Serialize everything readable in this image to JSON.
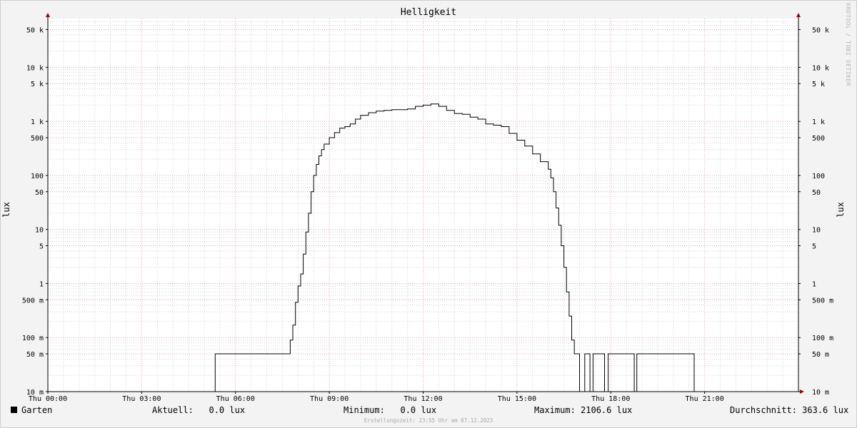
{
  "chart_data": {
    "type": "line",
    "title": "Helligkeit",
    "ylabel": "lux",
    "y_scale": "log",
    "ylim": [
      0.01,
      80000
    ],
    "xlim": [
      "00:00",
      "24:00"
    ],
    "x_ticks": [
      {
        "t": 0,
        "label": "Thu 00:00"
      },
      {
        "t": 3,
        "label": "Thu 03:00"
      },
      {
        "t": 6,
        "label": "Thu 06:00"
      },
      {
        "t": 9,
        "label": "Thu 09:00"
      },
      {
        "t": 12,
        "label": "Thu 12:00"
      },
      {
        "t": 15,
        "label": "Thu 15:00"
      },
      {
        "t": 18,
        "label": "Thu 18:00"
      },
      {
        "t": 21,
        "label": "Thu 21:00"
      }
    ],
    "y_ticks": [
      {
        "v": 0.01,
        "label": "10 m"
      },
      {
        "v": 0.05,
        "label": "50 m"
      },
      {
        "v": 0.1,
        "label": "100 m"
      },
      {
        "v": 0.5,
        "label": "500 m"
      },
      {
        "v": 1,
        "label": "1"
      },
      {
        "v": 5,
        "label": "5"
      },
      {
        "v": 10,
        "label": "10"
      },
      {
        "v": 50,
        "label": "50"
      },
      {
        "v": 100,
        "label": "100"
      },
      {
        "v": 500,
        "label": "500"
      },
      {
        "v": 1000,
        "label": "1 k"
      },
      {
        "v": 5000,
        "label": "5 k"
      },
      {
        "v": 10000,
        "label": "10 k"
      },
      {
        "v": 50000,
        "label": "50 k"
      }
    ],
    "colors": {
      "line": "#000000",
      "major_grid": "#e8a0a8",
      "minor_grid": "#d4d4d4",
      "axis": "#000000",
      "arrow": "#a00000",
      "plot_bg": "#ffffff"
    },
    "series": [
      {
        "name": "Garten",
        "x": [
          "00:00",
          "05:20",
          "05:21",
          "07:40",
          "07:45",
          "07:50",
          "07:55",
          "08:00",
          "08:05",
          "08:10",
          "08:15",
          "08:20",
          "08:25",
          "08:30",
          "08:35",
          "08:40",
          "08:45",
          "08:50",
          "09:00",
          "09:10",
          "09:20",
          "09:30",
          "09:40",
          "09:50",
          "10:00",
          "10:15",
          "10:30",
          "10:45",
          "11:00",
          "11:15",
          "11:30",
          "11:45",
          "12:00",
          "12:15",
          "12:30",
          "12:45",
          "13:00",
          "13:15",
          "13:30",
          "13:45",
          "14:00",
          "14:15",
          "14:30",
          "14:45",
          "15:00",
          "15:15",
          "15:30",
          "15:45",
          "16:00",
          "16:05",
          "16:10",
          "16:15",
          "16:20",
          "16:25",
          "16:30",
          "16:35",
          "16:40",
          "16:45",
          "16:50",
          "16:55",
          "17:00",
          "17:05",
          "17:10",
          "17:15",
          "17:20",
          "17:22",
          "17:26",
          "17:27",
          "17:48",
          "17:49",
          "17:55",
          "17:56",
          "18:45",
          "18:46",
          "18:50",
          "18:51",
          "20:40",
          "20:41",
          "20:46",
          "20:47",
          "22:05",
          "22:06",
          "22:15",
          "22:16",
          "24:00"
        ],
        "y": [
          0.01,
          0.01,
          0.05,
          0.05,
          0.09,
          0.17,
          0.45,
          0.9,
          1.5,
          3.5,
          9,
          20,
          50,
          100,
          160,
          230,
          300,
          380,
          500,
          620,
          750,
          800,
          900,
          1100,
          1300,
          1450,
          1550,
          1600,
          1650,
          1650,
          1700,
          1900,
          2000,
          2106.6,
          1900,
          1600,
          1400,
          1350,
          1200,
          1100,
          900,
          850,
          800,
          600,
          450,
          350,
          250,
          180,
          130,
          90,
          50,
          25,
          12,
          5,
          2,
          0.7,
          0.25,
          0.09,
          0.05,
          0.05,
          0.01,
          0.01,
          0.05,
          0.05,
          0.01,
          0.01,
          0.05,
          0.05,
          0.01,
          0.01,
          0.05,
          0.05,
          0.01,
          0.01,
          0.05,
          0.05,
          0.01,
          0.01,
          0.0,
          0.0,
          0.0,
          0.0,
          0.0,
          0.0,
          0.0
        ]
      }
    ]
  },
  "page": {
    "watermark": "RRDTOOL / TOBI OETIKER",
    "footer": "Erstellungszeit: 23:55 Uhr am 07.12.2023"
  },
  "legend": {
    "name": "Garten",
    "current": "Aktuell:   0.0 lux",
    "minimum": "Minimum:   0.0 lux",
    "maximum": "Maximum: 2106.6 lux",
    "average": "Durchschnitt: 363.6 lux"
  }
}
